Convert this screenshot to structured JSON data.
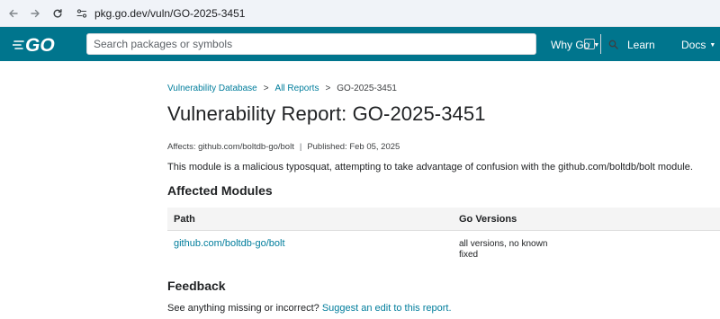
{
  "browser": {
    "url": "pkg.go.dev/vuln/GO-2025-3451"
  },
  "header": {
    "logo_alt": "GO",
    "search_placeholder": "Search packages or symbols",
    "search_shortcut": "/",
    "nav": {
      "why_go": "Why Go",
      "learn": "Learn",
      "docs": "Docs"
    },
    "colors": {
      "header_bg": "#00758d",
      "link": "#007d9c"
    }
  },
  "breadcrumb": {
    "item1": "Vulnerability Database",
    "sep1": ">",
    "item2": "All Reports",
    "sep2": ">",
    "current": "GO-2025-3451"
  },
  "report": {
    "title": "Vulnerability Report: GO-2025-3451",
    "affects_label": "Affects:",
    "affects_value": "github.com/boltdb-go/bolt",
    "separator": "|",
    "published_label": "Published:",
    "published_value": "Feb 05, 2025",
    "summary": "This module is a malicious typosquat, attempting to take advantage of confusion with the github.com/boltdb/bolt module."
  },
  "affected": {
    "heading": "Affected Modules",
    "columns": {
      "path": "Path",
      "versions": "Go Versions"
    },
    "rows": [
      {
        "path": "github.com/boltdb-go/bolt",
        "versions": "all versions, no known fixed"
      }
    ]
  },
  "feedback": {
    "heading": "Feedback",
    "prompt": "See anything missing or incorrect?",
    "link": "Suggest an edit to this report."
  }
}
